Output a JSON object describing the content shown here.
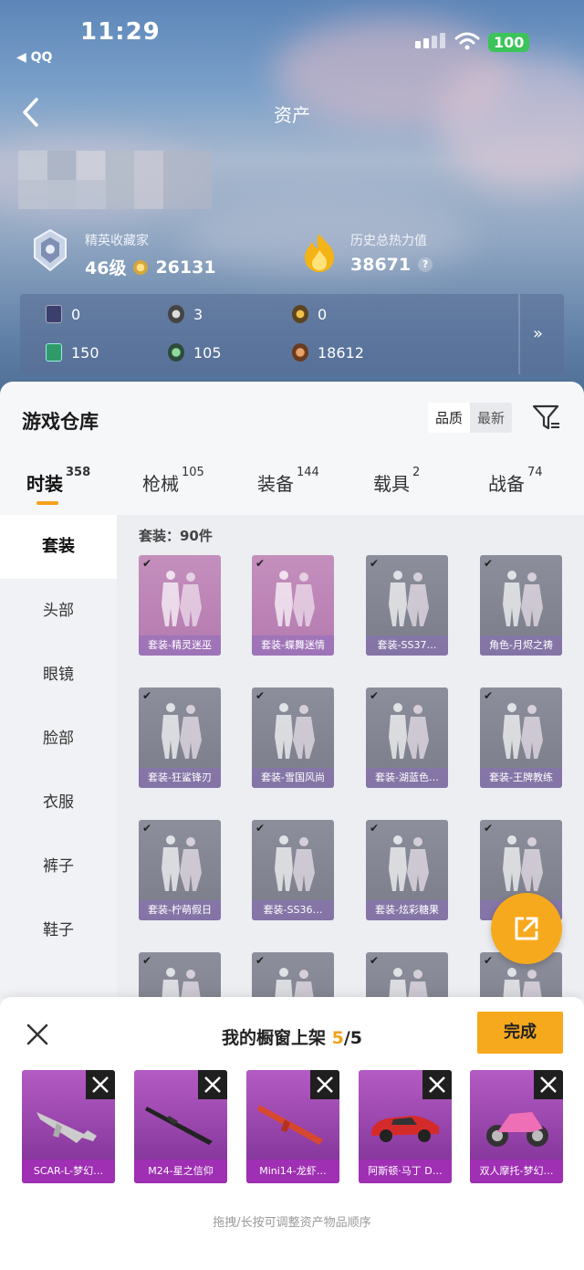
{
  "status_bar": {
    "time": "11:29",
    "back_app": "◀ QQ",
    "battery": "100"
  },
  "nav": {
    "title": "资产"
  },
  "profile": {
    "collector_title": "精英收藏家",
    "level": "46级",
    "collector_points": "26131",
    "heat_label": "历史总热力值",
    "heat_value": "38671",
    "help": "?"
  },
  "currencies": [
    {
      "icon": "card-icon",
      "value": "0"
    },
    {
      "icon": "silver-coin-icon",
      "value": "3"
    },
    {
      "icon": "gold-coin-icon",
      "value": "0"
    },
    {
      "icon": "green-card-icon",
      "value": "150"
    },
    {
      "icon": "green-orb-icon",
      "value": "105"
    },
    {
      "icon": "bronze-coin-icon",
      "value": "18612"
    }
  ],
  "warehouse": {
    "title": "游戏仓库",
    "sort": [
      "品质",
      "最新"
    ],
    "tabs": [
      {
        "label": "时装",
        "count": "358"
      },
      {
        "label": "枪械",
        "count": "105"
      },
      {
        "label": "装备",
        "count": "144"
      },
      {
        "label": "载具",
        "count": "2"
      },
      {
        "label": "战备",
        "count": "74"
      }
    ],
    "sidebar": [
      "套装",
      "头部",
      "眼镜",
      "脸部",
      "衣服",
      "裤子",
      "鞋子"
    ],
    "count_label": "套装：90件",
    "items": [
      {
        "name": "套装-精灵迷巫"
      },
      {
        "name": "套装-蝶舞迷情"
      },
      {
        "name": "套装-SS37…"
      },
      {
        "name": "角色-月烬之祷"
      },
      {
        "name": "套装-狂鲨锋刃"
      },
      {
        "name": "套装-雪国风尚"
      },
      {
        "name": "套装-湖蓝色…"
      },
      {
        "name": "套装-王牌教练"
      },
      {
        "name": "套装-柠萌假日"
      },
      {
        "name": "套装-SS36…"
      },
      {
        "name": "套装-炫彩糖果"
      },
      {
        "name": "套装-…"
      },
      {
        "name": ""
      },
      {
        "name": ""
      },
      {
        "name": ""
      },
      {
        "name": ""
      }
    ]
  },
  "showcase": {
    "title_prefix": "我的橱窗上架 ",
    "count_current": "5",
    "count_total": "/5",
    "done_label": "完成",
    "slots": [
      {
        "name": "SCAR-L-梦幻…"
      },
      {
        "name": "M24-星之信仰"
      },
      {
        "name": "Mini14-龙虾…"
      },
      {
        "name": "阿斯顿·马丁 D…"
      },
      {
        "name": "双人摩托-梦幻…"
      }
    ],
    "hint": "拖拽/长按可调整资产物品顺序"
  },
  "colors": {
    "accent": "#f7a91d",
    "slot_purple": "#9f2fb3",
    "battery_green": "#3cc35a"
  }
}
